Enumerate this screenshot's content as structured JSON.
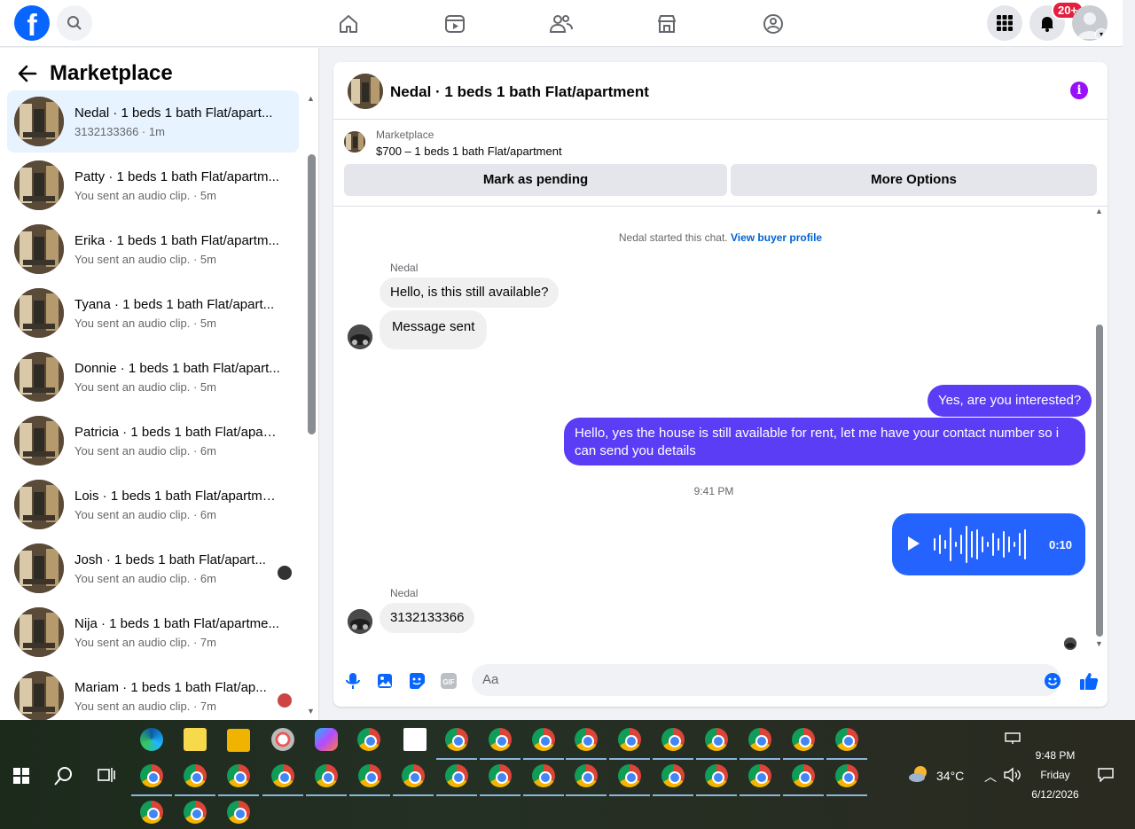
{
  "topbar": {
    "logo": "f",
    "notif_badge": "20+"
  },
  "left": {
    "title": "Marketplace",
    "conversations": [
      {
        "name": "Nedal · 1 beds 1 bath Flat/apart...",
        "sub": "3132133366 · 1m",
        "active": true
      },
      {
        "name": "Patty · 1 beds 1 bath Flat/apartm...",
        "sub": "You sent an audio clip. · 5m"
      },
      {
        "name": "Erika · 1 beds 1 bath Flat/apartm...",
        "sub": "You sent an audio clip. · 5m"
      },
      {
        "name": "Tyana · 1 beds 1 bath Flat/apart...",
        "sub": "You sent an audio clip. · 5m"
      },
      {
        "name": "Donnie · 1 beds 1 bath Flat/apart...",
        "sub": "You sent an audio clip. · 5m"
      },
      {
        "name": "Patricia · 1 beds 1 bath Flat/apart...",
        "sub": "You sent an audio clip. · 6m"
      },
      {
        "name": "Lois · 1 beds 1 bath Flat/apartment",
        "sub": "You sent an audio clip. · 6m"
      },
      {
        "name": "Josh · 1 beds 1 bath Flat/apart...",
        "sub": "You sent an audio clip. · 6m"
      },
      {
        "name": "Nija · 1 beds 1 bath Flat/apartme...",
        "sub": "You sent an audio clip. · 7m"
      },
      {
        "name": "Mariam · 1 beds 1 bath Flat/ap...",
        "sub": "You sent an audio clip. · 7m"
      }
    ]
  },
  "chat": {
    "title": "Nedal · 1 beds 1 bath Flat/apartment",
    "listing_source": "Marketplace",
    "listing_price": "$700 – 1 beds 1 bath Flat/apartment",
    "mark_pending": "Mark as pending",
    "more_options": "More Options",
    "started_text": "Nedal started this chat.",
    "view_profile": "View buyer profile",
    "sender_name": "Nedal",
    "msg1": "Hello, is this still available?",
    "msg2": "Message sent",
    "reply1": "Yes, are you interested?",
    "reply2": "Hello, yes the house is still available for rent, let me have your contact number so i can send you details",
    "timestamp": "9:41 PM",
    "audio_duration": "0:10",
    "msg3": "3132133366",
    "input_placeholder": "Aa",
    "accent": "#5b3df5"
  },
  "taskbar": {
    "temperature": "34°C",
    "time": "9:48 PM",
    "day": "Friday",
    "date": "6/12/2026"
  }
}
